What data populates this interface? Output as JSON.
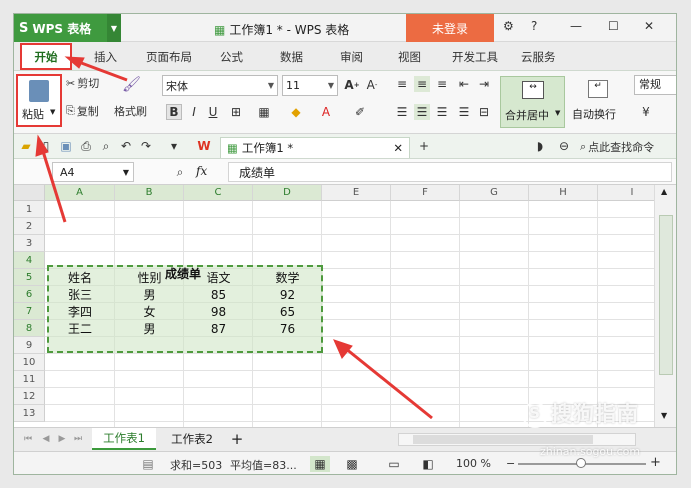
{
  "titlebar": {
    "app_label": "WPS 表格",
    "doc_title": "工作簿1 * - WPS 表格",
    "login_label": "未登录",
    "skin_label": "⚙",
    "help_label": "?",
    "min_label": "—",
    "max_label": "☐",
    "close_label": "✕"
  },
  "menubar": {
    "items": [
      "开始",
      "插入",
      "页面布局",
      "公式",
      "数据",
      "审阅",
      "视图",
      "开发工具",
      "云服务"
    ]
  },
  "ribbon": {
    "paste_label": "粘贴",
    "cut_label": "剪切",
    "copy_label": "复制",
    "format_painter_label": "格式刷",
    "font_name": "宋体",
    "font_size": "11",
    "merge_label": "合并居中",
    "wrap_label": "自动换行",
    "general_label": "常规"
  },
  "quickbar": {
    "file_tab_label": "工作簿1 *",
    "search_label": "点此查找命令"
  },
  "formula_bar": {
    "name_box": "A4",
    "fx_label": "fx",
    "content": "成绩单"
  },
  "columns": [
    "A",
    "B",
    "C",
    "D",
    "E",
    "F",
    "G",
    "H",
    "I"
  ],
  "rows": [
    "1",
    "2",
    "3",
    "4",
    "5",
    "6",
    "7",
    "8",
    "9",
    "10",
    "11",
    "12",
    "13"
  ],
  "table": {
    "title": "成绩单",
    "headers": [
      "姓名",
      "性别",
      "语文",
      "数学"
    ],
    "data": [
      [
        "张三",
        "男",
        "85",
        "92"
      ],
      [
        "李四",
        "女",
        "98",
        "65"
      ],
      [
        "王二",
        "男",
        "87",
        "76"
      ]
    ]
  },
  "sheets": [
    "工作表1",
    "工作表2"
  ],
  "add_sheet_label": "+",
  "statusbar": {
    "sum_label": "求和=503",
    "avg_label": "平均值=83...",
    "zoom_label": "100 %",
    "zoom_minus": "−",
    "zoom_plus": "+"
  },
  "watermark": {
    "brand": "搜狗指南",
    "url": "zhinan.sogou.com"
  },
  "colors": {
    "accent": "#3f9a3f",
    "highlight_red": "#e53935",
    "selection_fill": "#d0e6c7",
    "login_bg": "#ec6b42"
  }
}
